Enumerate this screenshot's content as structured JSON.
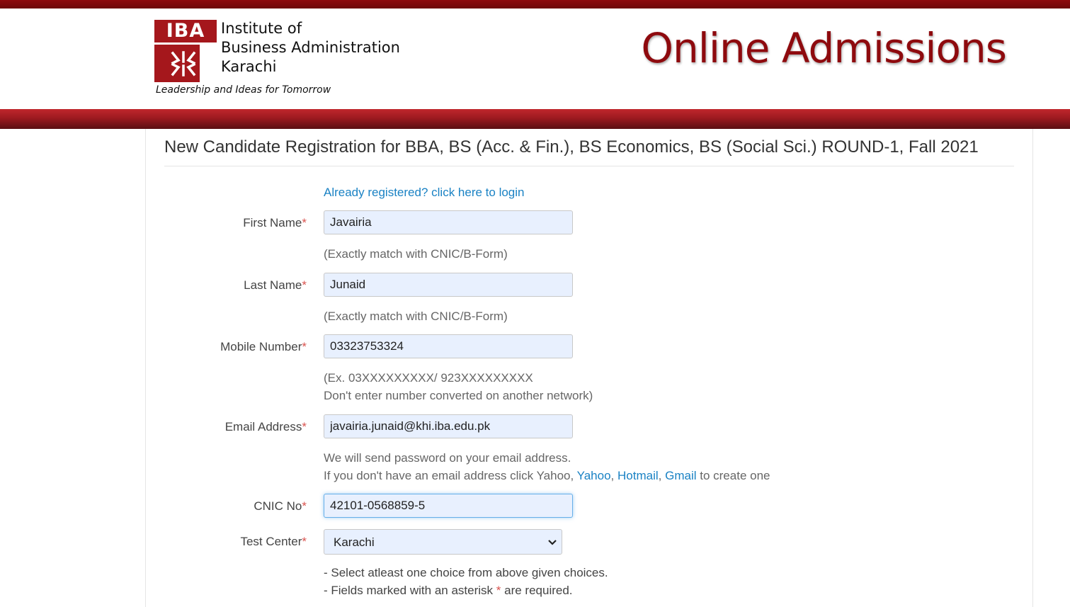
{
  "header": {
    "logo_text": "IBA",
    "institute_lines": [
      "Institute of",
      "Business Administration",
      "Karachi"
    ],
    "tagline": "Leadership and Ideas for Tomorrow",
    "site_title": "Online Admissions"
  },
  "colors": {
    "brand_red": "#a5171c",
    "title_red": "#8e0a0e",
    "link_blue": "#1a82c4",
    "required_red": "#d9534f",
    "autofill_bg": "#e8f0fe"
  },
  "form": {
    "title": "New Candidate Registration for BBA, BS (Acc. & Fin.), BS Economics, BS (Social Sci.) ROUND-1, Fall 2021",
    "login_link": "Already registered? click here to login",
    "required_marker": "*",
    "first_name": {
      "label": "First Name",
      "value": "Javairia",
      "help": "(Exactly match with CNIC/B-Form)"
    },
    "last_name": {
      "label": "Last Name",
      "value": "Junaid",
      "help": "(Exactly match with CNIC/B-Form)"
    },
    "mobile": {
      "label": "Mobile Number",
      "value": "03323753324",
      "help_line1": "(Ex. 03XXXXXXXXX/ 923XXXXXXXXX",
      "help_line2": "Don't enter number converted on another network)"
    },
    "email": {
      "label": "Email Address",
      "value": "javairia.junaid@khi.iba.edu.pk",
      "help_line1": "We will send password on your email address.",
      "help_line2_prefix": "If you don't have an email address click Yahoo,",
      "link_yahoo": "Yahoo",
      "link_hotmail": "Hotmail",
      "link_gmail": "Gmail",
      "help_line2_suffix": "to create one",
      "sep": ","
    },
    "cnic": {
      "label": "CNIC No",
      "value": "42101-0568859-5"
    },
    "test_center": {
      "label": "Test Center",
      "selected": "Karachi"
    },
    "notes": {
      "line1": "- Select atleast one choice from above given choices.",
      "line2_prefix": "- Fields marked with an asterisk",
      "line2_suffix": "are required."
    }
  }
}
